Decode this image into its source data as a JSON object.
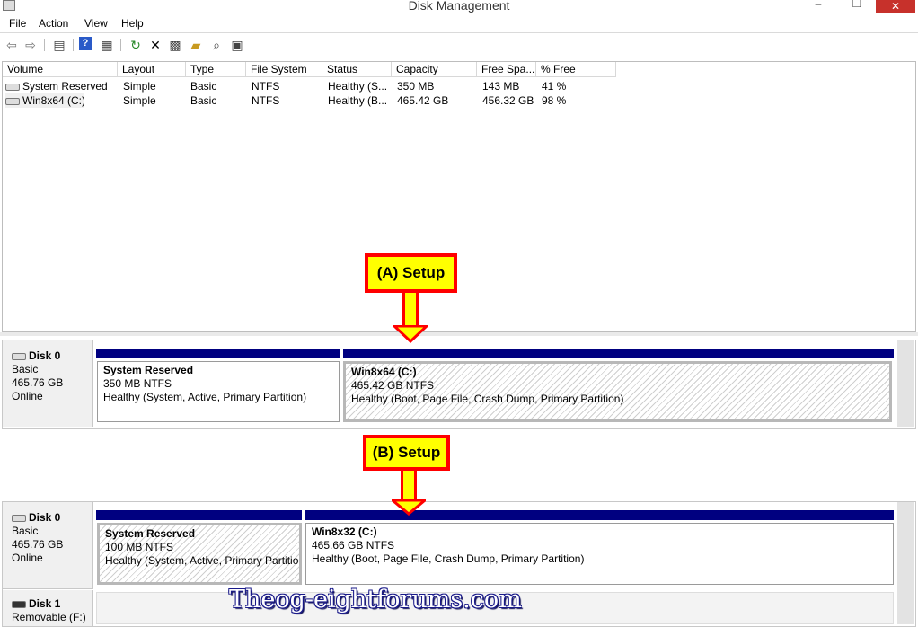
{
  "window": {
    "title": "Disk Management",
    "minimize": "–",
    "maximize": "❐",
    "close": "✕"
  },
  "menu": [
    "File",
    "Action",
    "View",
    "Help"
  ],
  "toolbar_icons": [
    "back-arrow-icon",
    "forward-arrow-icon",
    "console-tree-icon",
    "help-icon",
    "properties-icon",
    "refresh-icon",
    "delete-icon",
    "new-icon",
    "open-folder-icon",
    "search-icon",
    "settings-icon"
  ],
  "volume_list": {
    "columns": [
      "Volume",
      "Layout",
      "Type",
      "File System",
      "Status",
      "Capacity",
      "Free Spa...",
      "% Free"
    ],
    "rows": [
      [
        "System Reserved",
        "Simple",
        "Basic",
        "NTFS",
        "Healthy (S...",
        "350 MB",
        "143 MB",
        "41 %"
      ],
      [
        "Win8x64 (C:)",
        "Simple",
        "Basic",
        "NTFS",
        "Healthy (B...",
        "465.42 GB",
        "456.32 GB",
        "98 %"
      ]
    ]
  },
  "setup_a": {
    "callout": "(A) Setup",
    "disk": {
      "name": "Disk 0",
      "type": "Basic",
      "size": "465.76 GB",
      "state": "Online"
    },
    "partitions": [
      {
        "label": "System Reserved",
        "size": "350 MB NTFS",
        "status": "Healthy (System, Active, Primary Partition)"
      },
      {
        "label": "Win8x64  (C:)",
        "size": "465.42 GB NTFS",
        "status": "Healthy (Boot, Page File, Crash Dump, Primary Partition)"
      }
    ]
  },
  "setup_b": {
    "callout": "(B) Setup",
    "disk": {
      "name": "Disk 0",
      "type": "Basic",
      "size": "465.76 GB",
      "state": "Online"
    },
    "partitions": [
      {
        "label": "System Reserved",
        "size": "100 MB NTFS",
        "status": "Healthy (System, Active, Primary Partition)"
      },
      {
        "label": "Win8x32  (C:)",
        "size": "465.66 GB NTFS",
        "status": "Healthy (Boot, Page File, Crash Dump, Primary Partition)"
      }
    ],
    "disk1": {
      "name": "Disk 1",
      "type": "Removable (F:)"
    }
  },
  "watermark": "Theog-eightforums.com",
  "colors": {
    "partition_bar": "#000080",
    "callout_fill": "#ffff00",
    "callout_border": "#ff0000",
    "close_button": "#c7312b"
  }
}
